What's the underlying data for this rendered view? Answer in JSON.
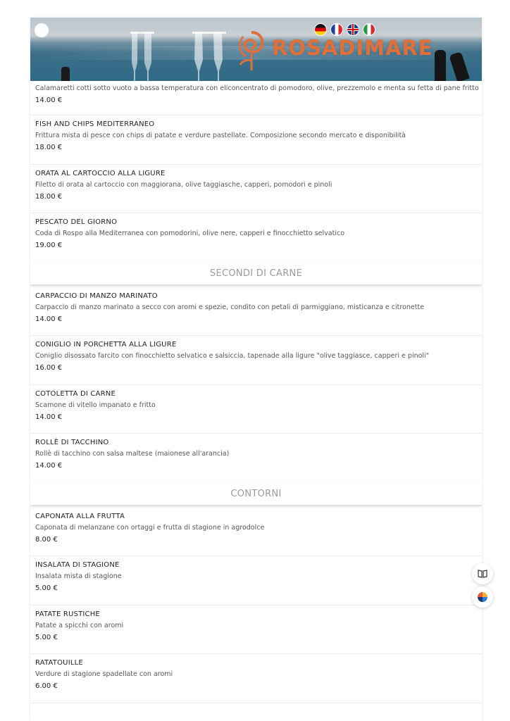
{
  "header": {
    "brand": "ROSADIMARE",
    "languages": [
      {
        "code": "de",
        "icon": "germany-flag-icon"
      },
      {
        "code": "fr",
        "icon": "france-flag-icon"
      },
      {
        "code": "en",
        "icon": "uk-flag-icon"
      },
      {
        "code": "it",
        "icon": "italy-flag-icon"
      }
    ]
  },
  "partial_item": {
    "desc": "Calamaretti cotti sotto vuoto a bassa temperatura con eliconcentrato di pomodoro, olive, prezzemolo e menta su fetta di pane fritto",
    "price": "14.00 €"
  },
  "sections": [
    {
      "label": "",
      "items": [
        {
          "title": "FISH AND CHIPS MEDITERRANEO",
          "desc": "Frittura mista di pesce con chips di patate e verdure pastellate. Composizione secondo mercato e disponibilità",
          "price": "18.00 €"
        },
        {
          "title": "ORATA AL CARTOCCIO ALLA LIGURE",
          "desc": "Filetto di orata al cartoccio con maggiorana, olive taggiasche, capperi, pomodori e pinoli",
          "price": "18.00 €"
        },
        {
          "title": "PESCATO DEL GIORNO",
          "desc": "Coda di Rospo alla Mediterranea con pomodorini, olive nere, capperi e finocchietto selvatico",
          "price": "19.00 €"
        }
      ]
    },
    {
      "label": "SECONDI DI CARNE",
      "items": [
        {
          "title": "CARPACCIO DI MANZO MARINATO",
          "desc": "Carpaccio di manzo marinato a secco con aromi e spezie, condito con petali di parmiggiano, misticanza e citronette",
          "price": "14.00 €"
        },
        {
          "title": "CONIGLIO IN PORCHETTA ALLA LIGURE",
          "desc": "Coniglio disossato farcito con finocchietto selvatico e salsiccia, tapenade alla ligure \"olive taggiasce, capperi e pinoli\"",
          "price": "16.00 €"
        },
        {
          "title": "COTOLETTA DI CARNE",
          "desc": "Scamone di vitello impanato e fritto",
          "price": "14.00 €"
        },
        {
          "title": "ROLLÈ DI TACCHINO",
          "desc": "Rollè di tacchino con salsa maltese (maionese all'arancia)",
          "price": "14.00 €"
        }
      ]
    },
    {
      "label": "CONTORNI",
      "items": [
        {
          "title": "CAPONATA ALLA FRUTTA",
          "desc": "Caponata di melanzane con ortaggi e frutta di stagione in agrodolce",
          "price": "8.00 €"
        },
        {
          "title": "INSALATA DI STAGIONE",
          "desc": "Insalata mista di stagione",
          "price": "5.00 €"
        },
        {
          "title": "PATATE RUSTICHE",
          "desc": "Patate a spicchi con aromi",
          "price": "5.00 €"
        },
        {
          "title": "RATATOUILLE",
          "desc": "Verdure di stagione spadellate con aromi",
          "price": "6.00 €"
        }
      ]
    }
  ],
  "side_widgets": [
    {
      "icon": "book-icon"
    },
    {
      "icon": "color-wheel-icon"
    }
  ],
  "colors": {
    "brand": "#e0703a",
    "section_label": "#9a9a9a",
    "divider": "#ececec"
  }
}
